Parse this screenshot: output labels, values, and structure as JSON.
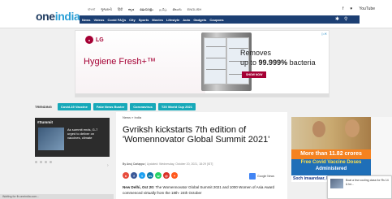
{
  "header": {
    "logo_one": "one",
    "logo_india": "india",
    "languages": [
      "বাংলা",
      "ગુજરાતી",
      "हिंदी",
      "ಕನ್ನಡ",
      "മലയാളം",
      "தமிழ்",
      "తెలుగు",
      "ENGLISH"
    ],
    "nav": [
      "News",
      "Videos",
      "Covid FAQs",
      "City",
      "Sports",
      "Movies",
      "Lifestyle",
      "Auto",
      "Gadgets",
      "Coupons"
    ],
    "social": [
      "f",
      "♥",
      "YouTube"
    ]
  },
  "ad_banner": {
    "brand": "LG",
    "product": "Hygiene Fresh+™",
    "removes": "Removes",
    "upto_prefix": "up to",
    "percent": "99.999%",
    "suffix": "bacteria",
    "cta": "SHOW NOW"
  },
  "trending": {
    "label": "TRENDING",
    "tags": [
      "Covid-19 Vaccine",
      "Fake News Buster",
      "Coronavirus",
      "T20 World Cup 2021"
    ]
  },
  "left_card": {
    "hashtag": "#Summit",
    "story": "As summit ends, G-7 urged to deliver on vaccines, climate"
  },
  "article": {
    "breadcrumb": "News » India",
    "title": "Gvriksh kickstarts 7th edition of 'Womennovator Global Summit 2021'",
    "author": "By Anuj Cariappa",
    "updated": "| Updated: Wednesday, October 20, 2021, 18:29 [IST]",
    "google_news_label": "Google News",
    "lead_bold": "New Delhi, Oct 20:",
    "lead_rest": "The Womennovator Global Summit 2021 and 1000 Women of Asia Award commenced virtually from the 18th- 24th October"
  },
  "right_ad": {
    "line1": "More than 11.82 crores",
    "line2": "Free Covid Vaccine Doses",
    "line3": "Administered",
    "line4": "Soch imaandaar, Kaam Dumdaar"
  },
  "notification": {
    "text": "Boat a few cooling class for Rs 14 & he..."
  },
  "status_bar": {
    "text": "Waiting for fb.oneindia.com..."
  }
}
